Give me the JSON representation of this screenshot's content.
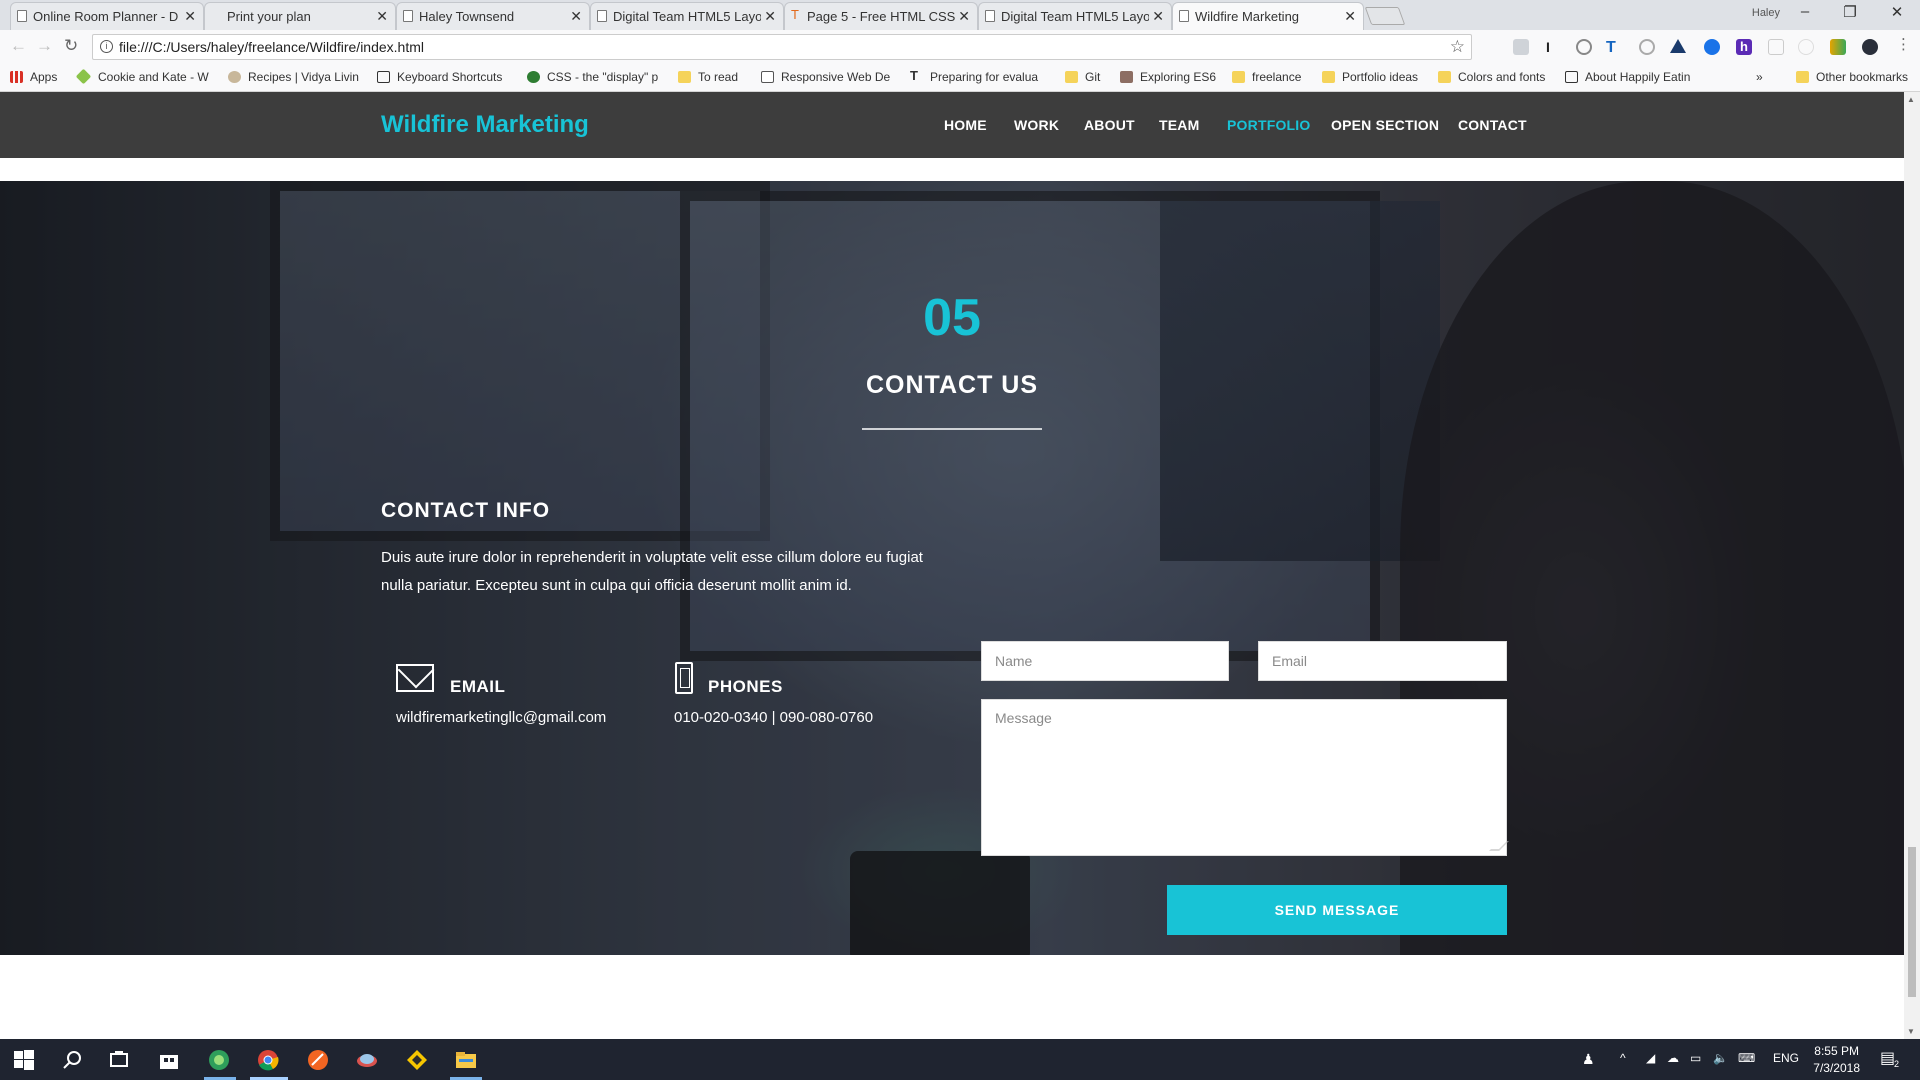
{
  "browser": {
    "tabs": [
      {
        "label": "Online Room Planner - D"
      },
      {
        "label": "Print your plan"
      },
      {
        "label": "Haley Townsend"
      },
      {
        "label": "Digital Team HTML5 Layo"
      },
      {
        "label": "Page 5 - Free HTML CSS"
      },
      {
        "label": "Digital Team HTML5 Layo"
      },
      {
        "label": "Wildfire Marketing"
      }
    ],
    "user": "Haley",
    "url": "file:///C:/Users/haley/freelance/Wildfire/index.html",
    "bookmarks": [
      {
        "label": "Apps"
      },
      {
        "label": "Cookie and Kate - W"
      },
      {
        "label": "Recipes | Vidya Livin"
      },
      {
        "label": "Keyboard Shortcuts"
      },
      {
        "label": "CSS - the \"display\" p"
      },
      {
        "label": "To read"
      },
      {
        "label": "Responsive Web De"
      },
      {
        "label": "Preparing for evalua"
      },
      {
        "label": "Git"
      },
      {
        "label": "Exploring ES6"
      },
      {
        "label": "freelance"
      },
      {
        "label": "Portfolio ideas"
      },
      {
        "label": "Colors and fonts"
      },
      {
        "label": "About Happily Eatin"
      }
    ],
    "overflow": "»",
    "other_bookmarks": "Other bookmarks"
  },
  "site": {
    "brand": "Wildfire Marketing",
    "nav": [
      {
        "label": "HOME"
      },
      {
        "label": "WORK"
      },
      {
        "label": "ABOUT"
      },
      {
        "label": "TEAM"
      },
      {
        "label": "PORTFOLIO",
        "active": true
      },
      {
        "label": "OPEN SECTION"
      },
      {
        "label": "CONTACT"
      }
    ],
    "accent_color": "#18c3d6",
    "contact": {
      "number": "05",
      "title": "CONTACT US",
      "info_title": "CONTACT INFO",
      "info_text": "Duis aute irure dolor in reprehenderit in voluptate velit esse cillum dolore eu fugiat nulla pariatur. Excepteu sunt in culpa qui officia deserunt mollit anim id.",
      "email_label": "EMAIL",
      "email_value": "wildfiremarketingllc@gmail.com",
      "phones_label": "PHONES",
      "phones_value": "010-020-0340 | 090-080-0760",
      "form": {
        "name_placeholder": "Name",
        "email_placeholder": "Email",
        "message_placeholder": "Message",
        "submit_label": "SEND MESSAGE"
      }
    }
  },
  "taskbar": {
    "lang": "ENG",
    "time": "8:55 PM",
    "date": "7/3/2018",
    "notifications": "2"
  }
}
